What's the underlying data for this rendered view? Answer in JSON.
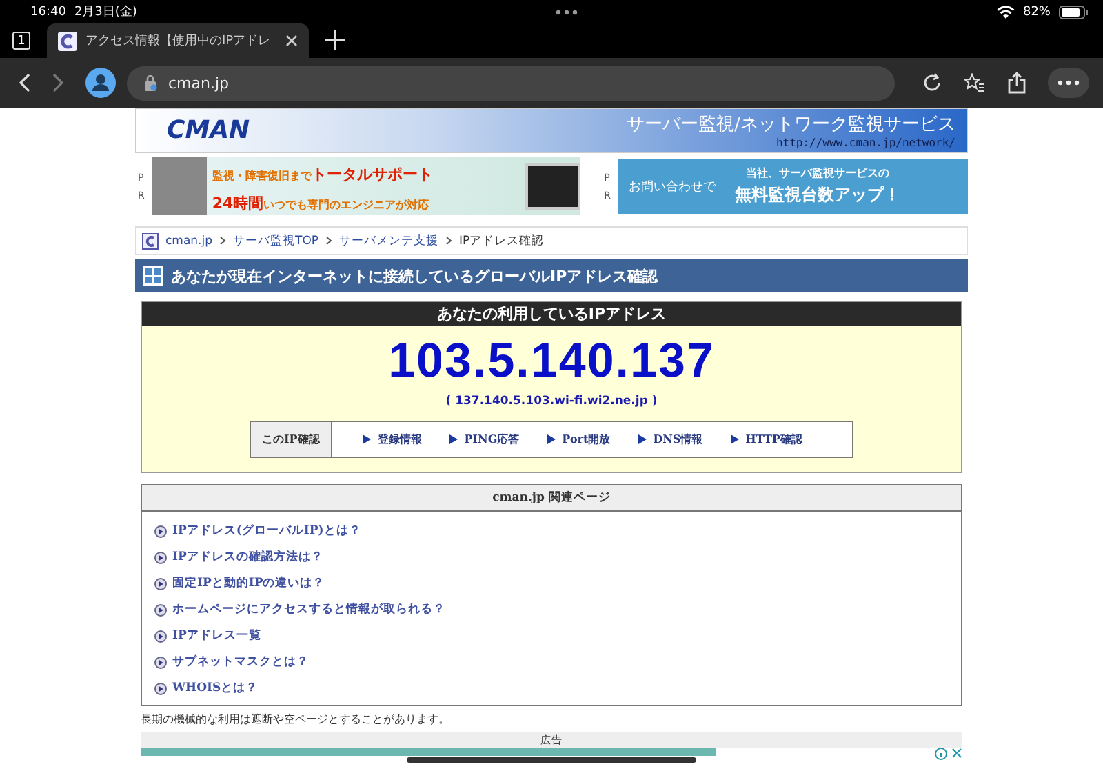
{
  "status_bar": {
    "time": "16:40",
    "date": "2月3日(金)",
    "battery": "82%"
  },
  "browser": {
    "tab_count": "1",
    "tabs": [
      {
        "title": "アクセス情報【使用中のIPアドレ",
        "selected": true
      }
    ],
    "address": "cman.jp"
  },
  "header_banner": {
    "logo": "CMAN",
    "title": "サーバー監視/ネットワーク監視サービス",
    "url": "http://www.cman.jp/network/"
  },
  "ads": [
    {
      "pr": [
        "P",
        "R"
      ],
      "lines": [
        "監視・障害復旧まで",
        "トータルサポート",
        "24時間",
        "いつでも専門のエンジニアが対応"
      ],
      "kind": "support"
    },
    {
      "pr": [
        "P",
        "R"
      ],
      "lines": [
        "お問い合わせで",
        "当社、サーバ監視サービスの",
        "無料監視台数アップ！"
      ],
      "kind": "contact"
    }
  ],
  "breadcrumb": [
    "cman.jp",
    "サーバ監視TOP",
    "サーバメンテ支援",
    "IPアドレス確認"
  ],
  "page_title": "あなたが現在インターネットに接続しているグローバルIPアドレス確認",
  "ip_box": {
    "heading": "あなたの利用しているIPアドレス",
    "ip": "103.5.140.137",
    "hostname": "( 137.140.5.103.wi-fi.wi2.ne.jp )",
    "check_label": "このIP確認",
    "checks": [
      "登録情報",
      "PING応答",
      "Port開放",
      "DNS情報",
      "HTTP確認"
    ]
  },
  "related": {
    "heading": "cman.jp 関連ページ",
    "links": [
      "IPアドレス(グローバルIP)とは？",
      "IPアドレスの確認方法は？",
      "固定IPと動的IPの違いは？",
      "ホームページにアクセスすると情報が取られる？",
      "IPアドレス一覧",
      "サブネットマスクとは？",
      "WHOISとは？"
    ]
  },
  "notice": "長期の機械的な利用は遮断や空ページとすることがあります。",
  "ad_label": "広告"
}
